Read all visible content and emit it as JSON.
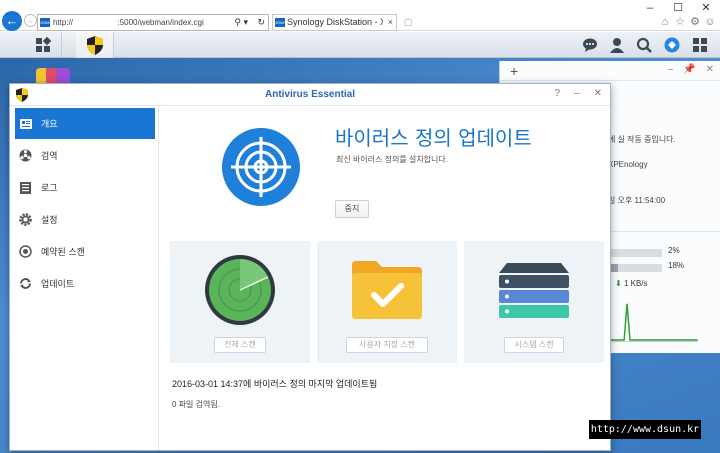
{
  "browser": {
    "url": "http://                    :5000/webman/index.cgi",
    "tab_title": "Synology DiskStation - XPEn...",
    "tab_close": "×",
    "favicon_text": "DSM",
    "window_controls": [
      "–",
      "☐",
      "✕"
    ]
  },
  "taskbar": {
    "icons": [
      "apps-grid-icon",
      "antivirus-shield-icon",
      "chat-icon",
      "user-icon",
      "search-icon",
      "dsm-widget-icon",
      "windows-icon"
    ]
  },
  "widget_panel": {
    "status_text": "에 실 작동 중입니다.",
    "hostname": "XPEnology",
    "time_text": "일 오후 11:54:00",
    "cpu_pct": "2%",
    "ram_pct": "18%",
    "cpu_fraction": 0.02,
    "ram_fraction": 0.18,
    "net_text": "1 KB/s",
    "net_arrow": "⬇"
  },
  "app": {
    "title": "Antivirus Essential",
    "controls": [
      "?",
      "–",
      "✕"
    ],
    "sidebar": [
      {
        "label": "개요",
        "icon": "overview-icon",
        "active": true
      },
      {
        "label": "검역",
        "icon": "quarantine-icon",
        "active": false
      },
      {
        "label": "로그",
        "icon": "log-icon",
        "active": false
      },
      {
        "label": "설정",
        "icon": "settings-icon",
        "active": false
      },
      {
        "label": "예약된 스캔",
        "icon": "scheduled-scan-icon",
        "active": false
      },
      {
        "label": "업데이트",
        "icon": "update-icon",
        "active": false
      }
    ],
    "hero": {
      "title": "바이러스 정의 업데이트",
      "subtitle": "최신 바이러스 정의를 설치합니다.",
      "stop_label": "중지"
    },
    "scans": [
      {
        "label": "전체 스캔",
        "icon": "radar-icon"
      },
      {
        "label": "사용자 지정 스캔",
        "icon": "folder-check-icon"
      },
      {
        "label": "시스템 스캔",
        "icon": "server-stack-icon"
      }
    ],
    "last_update": "2016-03-01 14:37에 바이러스 정의 마지막 업데이트됨",
    "files_checked": "0 파일 검역됨."
  },
  "colors": {
    "accent": "#1976d2",
    "title_blue": "#2d66b3",
    "desktop_blue": "#3a79c0"
  },
  "watermark": "http://www.dsun.kr"
}
